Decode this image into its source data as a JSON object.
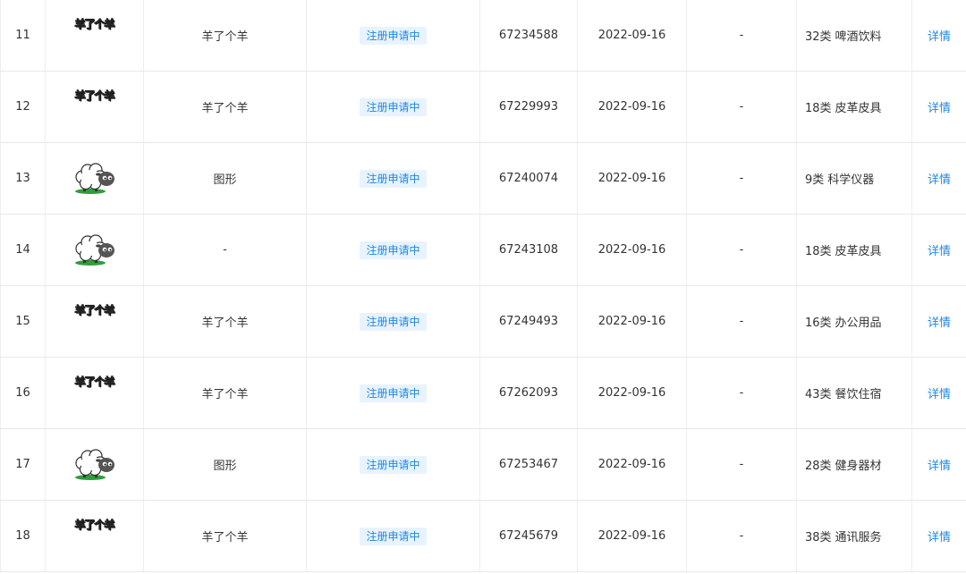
{
  "rows": [
    {
      "no": "11",
      "logo": "text",
      "logo_text": "羊了个羊",
      "name": "羊了个羊",
      "status": "注册申请中",
      "reg_no": "67234588",
      "date": "2022-09-16",
      "dash": "-",
      "class_num": "32类",
      "class_name": "啤酒饮料",
      "detail": "详情"
    },
    {
      "no": "12",
      "logo": "text",
      "logo_text": "羊了个羊",
      "name": "羊了个羊",
      "status": "注册申请中",
      "reg_no": "67229993",
      "date": "2022-09-16",
      "dash": "-",
      "class_num": "18类",
      "class_name": "皮革皮具",
      "detail": "详情"
    },
    {
      "no": "13",
      "logo": "sheep",
      "logo_text": "",
      "name": "图形",
      "status": "注册申请中",
      "reg_no": "67240074",
      "date": "2022-09-16",
      "dash": "-",
      "class_num": "9类",
      "class_name": "科学仪器",
      "detail": "详情"
    },
    {
      "no": "14",
      "logo": "sheep",
      "logo_text": "",
      "name": "-",
      "status": "注册申请中",
      "reg_no": "67243108",
      "date": "2022-09-16",
      "dash": "-",
      "class_num": "18类",
      "class_name": "皮革皮具",
      "detail": "详情"
    },
    {
      "no": "15",
      "logo": "text",
      "logo_text": "羊了个羊",
      "name": "羊了个羊",
      "status": "注册申请中",
      "reg_no": "67249493",
      "date": "2022-09-16",
      "dash": "-",
      "class_num": "16类",
      "class_name": "办公用品",
      "detail": "详情"
    },
    {
      "no": "16",
      "logo": "text",
      "logo_text": "羊了个羊",
      "name": "羊了个羊",
      "status": "注册申请中",
      "reg_no": "67262093",
      "date": "2022-09-16",
      "dash": "-",
      "class_num": "43类",
      "class_name": "餐饮住宿",
      "detail": "详情"
    },
    {
      "no": "17",
      "logo": "sheep",
      "logo_text": "",
      "name": "图形",
      "status": "注册申请中",
      "reg_no": "67253467",
      "date": "2022-09-16",
      "dash": "-",
      "class_num": "28类",
      "class_name": "健身器材",
      "detail": "详情"
    },
    {
      "no": "18",
      "logo": "text",
      "logo_text": "羊了个羊",
      "name": "羊了个羊",
      "status": "注册申请中",
      "reg_no": "67245679",
      "date": "2022-09-16",
      "dash": "-",
      "class_num": "38类",
      "class_name": "通讯服务",
      "detail": "详情"
    }
  ],
  "colors": {
    "status_bg": "#e8f3ff",
    "status_text": "#1e88e5",
    "link": "#1e88e5",
    "border": "#e8e8e8"
  }
}
